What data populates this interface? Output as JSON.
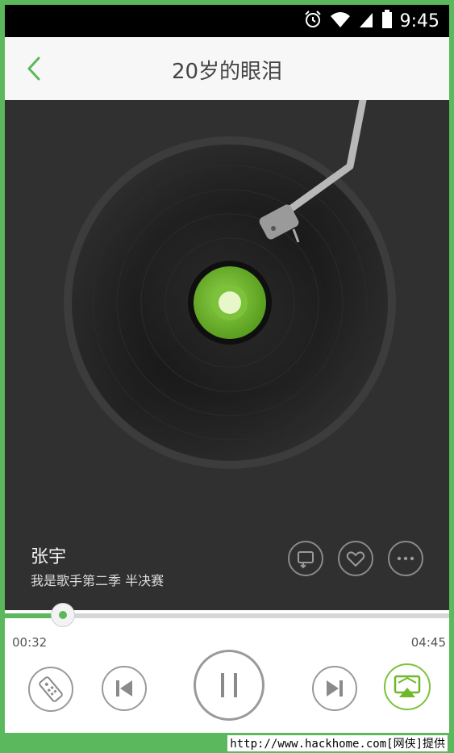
{
  "status_bar": {
    "time": "9:45",
    "icons": [
      "alarm-icon",
      "wifi-icon",
      "signal-icon",
      "battery-icon"
    ]
  },
  "header": {
    "title": "20岁的眼泪",
    "back_icon": "back-chevron-icon"
  },
  "now_playing": {
    "artist": "张宇",
    "album": "我是歌手第二季 半决赛"
  },
  "actions": [
    {
      "name": "repeat-icon"
    },
    {
      "name": "heart-icon"
    },
    {
      "name": "more-icon"
    }
  ],
  "progress": {
    "elapsed": "00:32",
    "total": "04:45",
    "fraction": 0.13
  },
  "controls": {
    "remote": "remote-icon",
    "previous": "previous-icon",
    "pause": "pause-icon",
    "next": "next-icon",
    "airplay": "airplay-icon"
  },
  "colors": {
    "accent": "#5cb85c",
    "player_bg": "#303030",
    "label_green": "#6fb82a"
  },
  "watermark": "http://www.hackhome.com[网侠]提供"
}
